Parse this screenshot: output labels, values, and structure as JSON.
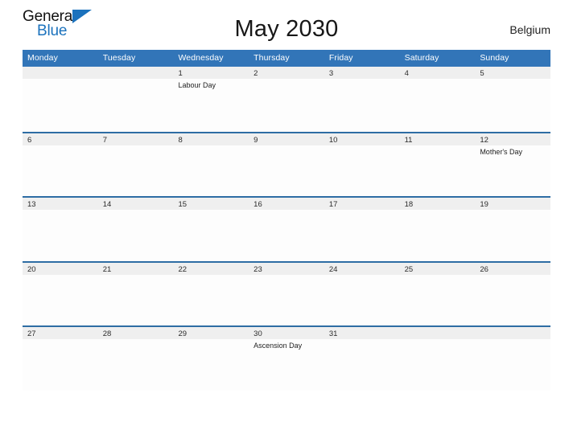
{
  "brand": {
    "name_top": "General",
    "name_bottom": "Blue",
    "accent_color": "#1b72bd"
  },
  "header": {
    "title": "May 2030",
    "country": "Belgium"
  },
  "theme": {
    "header_blue": "#3275b8",
    "row_border_blue": "#2e6da4",
    "date_strip_gray": "#efefef"
  },
  "calendar": {
    "weekdays": [
      "Monday",
      "Tuesday",
      "Wednesday",
      "Thursday",
      "Friday",
      "Saturday",
      "Sunday"
    ],
    "weeks": [
      [
        {
          "date": "",
          "events": []
        },
        {
          "date": "",
          "events": []
        },
        {
          "date": "1",
          "events": [
            "Labour Day"
          ]
        },
        {
          "date": "2",
          "events": []
        },
        {
          "date": "3",
          "events": []
        },
        {
          "date": "4",
          "events": []
        },
        {
          "date": "5",
          "events": []
        }
      ],
      [
        {
          "date": "6",
          "events": []
        },
        {
          "date": "7",
          "events": []
        },
        {
          "date": "8",
          "events": []
        },
        {
          "date": "9",
          "events": []
        },
        {
          "date": "10",
          "events": []
        },
        {
          "date": "11",
          "events": []
        },
        {
          "date": "12",
          "events": [
            "Mother's Day"
          ]
        }
      ],
      [
        {
          "date": "13",
          "events": []
        },
        {
          "date": "14",
          "events": []
        },
        {
          "date": "15",
          "events": []
        },
        {
          "date": "16",
          "events": []
        },
        {
          "date": "17",
          "events": []
        },
        {
          "date": "18",
          "events": []
        },
        {
          "date": "19",
          "events": []
        }
      ],
      [
        {
          "date": "20",
          "events": []
        },
        {
          "date": "21",
          "events": []
        },
        {
          "date": "22",
          "events": []
        },
        {
          "date": "23",
          "events": []
        },
        {
          "date": "24",
          "events": []
        },
        {
          "date": "25",
          "events": []
        },
        {
          "date": "26",
          "events": []
        }
      ],
      [
        {
          "date": "27",
          "events": []
        },
        {
          "date": "28",
          "events": []
        },
        {
          "date": "29",
          "events": []
        },
        {
          "date": "30",
          "events": [
            "Ascension Day"
          ]
        },
        {
          "date": "31",
          "events": []
        },
        {
          "date": "",
          "events": []
        },
        {
          "date": "",
          "events": []
        }
      ]
    ]
  }
}
